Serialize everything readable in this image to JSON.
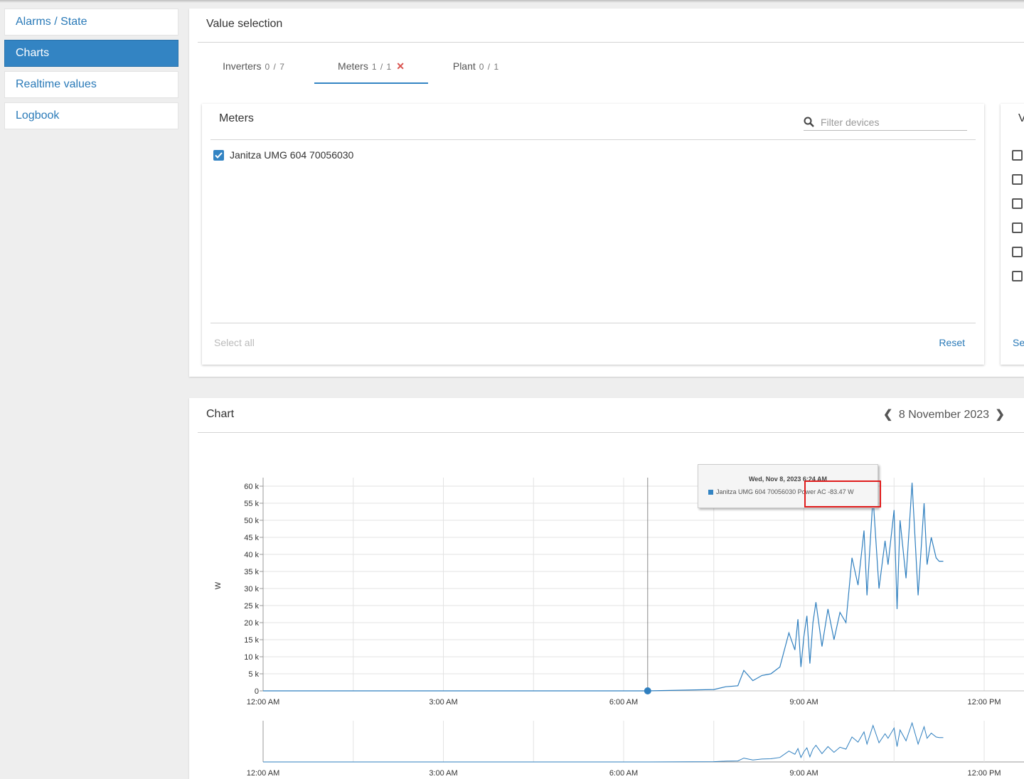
{
  "sidebar": {
    "items": [
      {
        "label": "Alarms / State",
        "active": false
      },
      {
        "label": "Charts",
        "active": true
      },
      {
        "label": "Realtime values",
        "active": false
      },
      {
        "label": "Logbook",
        "active": false
      }
    ]
  },
  "value_selection": {
    "title": "Value selection",
    "tabs": [
      {
        "label": "Inverters",
        "count": "0 / 7"
      },
      {
        "label": "Meters",
        "count": "1 / 1",
        "active": true
      },
      {
        "label": "Plant",
        "count": "0 / 1"
      }
    ],
    "meters_card": {
      "title": "Meters",
      "filter_placeholder": "Filter devices",
      "devices": [
        {
          "label": "Janitza UMG 604 70056030",
          "checked": true
        }
      ],
      "select_all": "Select all",
      "reset": "Reset"
    },
    "values_card": {
      "title_partial": "V",
      "footer_partial": "Se",
      "checkbox_count": 6
    }
  },
  "chart_panel": {
    "title": "Chart",
    "date": "8 November 2023",
    "tooltip": {
      "date": "Wed, Nov 8, 2023 6:24 AM",
      "series": "Janitza UMG 604 70056030",
      "value": "Power AC -83.47 W"
    }
  },
  "chart_data": {
    "type": "line",
    "ylabel": "W",
    "ylim": [
      0,
      60000
    ],
    "yticks": [
      "0",
      "5 k",
      "10 k",
      "15 k",
      "20 k",
      "25 k",
      "30 k",
      "35 k",
      "40 k",
      "45 k",
      "50 k",
      "55 k",
      "60 k"
    ],
    "xticks": [
      "12:00 AM",
      "3:00 AM",
      "6:00 AM",
      "9:00 AM",
      "12:00 PM"
    ],
    "x_hours": [
      0,
      6.4,
      7.5,
      7.7,
      7.9,
      8.0,
      8.15,
      8.3,
      8.45,
      8.6,
      8.75,
      8.85,
      8.9,
      8.95,
      9.0,
      9.05,
      9.1,
      9.15,
      9.2,
      9.3,
      9.4,
      9.5,
      9.6,
      9.7,
      9.8,
      9.9,
      10.0,
      10.05,
      10.15,
      10.25,
      10.35,
      10.4,
      10.5,
      10.55,
      10.6,
      10.7,
      10.8,
      10.9,
      11.0,
      11.05,
      11.12,
      11.2,
      11.25,
      11.32
    ],
    "series": [
      {
        "name": "Janitza UMG 604 70056030",
        "values": [
          0,
          -83,
          400,
          1200,
          1500,
          6000,
          3000,
          4500,
          5000,
          7000,
          17000,
          12000,
          21000,
          7000,
          16000,
          22000,
          8000,
          20000,
          26000,
          13000,
          24000,
          15000,
          23000,
          20000,
          39000,
          31000,
          47000,
          28000,
          57000,
          30000,
          44000,
          37000,
          53000,
          24000,
          50000,
          33000,
          61000,
          28000,
          55000,
          37000,
          45000,
          39000,
          38000,
          38000
        ]
      }
    ],
    "navigator": true,
    "tooltip_point_hour": 6.4
  }
}
